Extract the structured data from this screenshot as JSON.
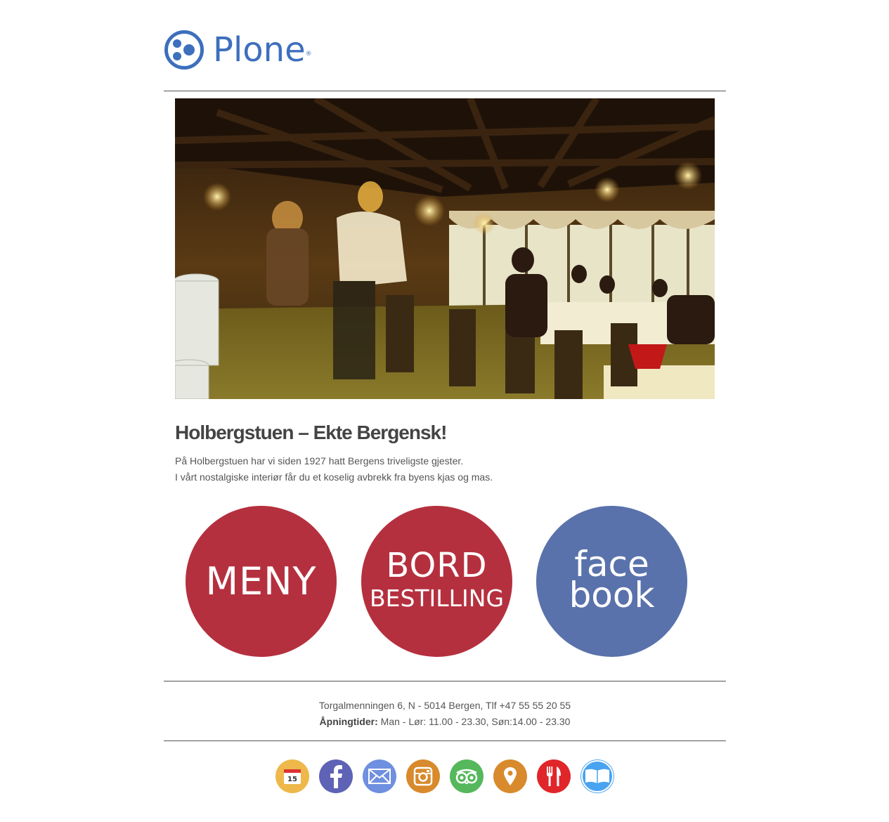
{
  "logo": {
    "text": "Plone",
    "reg": "®",
    "color": "#3d6fbd"
  },
  "hero": {
    "alt": "Restaurant interior"
  },
  "headline": "Holbergstuen – Ekte Bergensk!",
  "intro": {
    "line1": "På Holbergstuen har vi siden 1927 hatt Bergens triveligste gjester.",
    "line2": "I vårt nostalgiske interiør får du et koselig avbrekk fra byens kjas og mas."
  },
  "circles": {
    "meny": {
      "line1": "MENY",
      "color": "#b5303e"
    },
    "bord": {
      "line1": "BORD",
      "line2": "BESTILLING",
      "color": "#b5303e"
    },
    "facebook": {
      "line1": "face",
      "line2": "book",
      "color": "#5a72ab"
    }
  },
  "footer": {
    "address": "Torgalmenningen 6, N - 5014 Bergen, Tlf +47 55 55 20 55",
    "hours_label": "Åpningtider:",
    "hours_value": " Man - Lør: 11.00 - 23.30, Søn:14.00 - 23.30"
  },
  "social_icons": [
    {
      "name": "calendar-icon",
      "label": "15",
      "color": "#eeb84a"
    },
    {
      "name": "facebook-icon",
      "color": "#5e63b5"
    },
    {
      "name": "mail-icon",
      "color": "#6f8fe0"
    },
    {
      "name": "instagram-icon",
      "color": "#d88a2c"
    },
    {
      "name": "tripadvisor-icon",
      "color": "#55b85c"
    },
    {
      "name": "location-icon",
      "color": "#d88a2c"
    },
    {
      "name": "restaurant-icon",
      "color": "#e0262a"
    },
    {
      "name": "book-icon",
      "color": "#4aa3f0"
    }
  ]
}
